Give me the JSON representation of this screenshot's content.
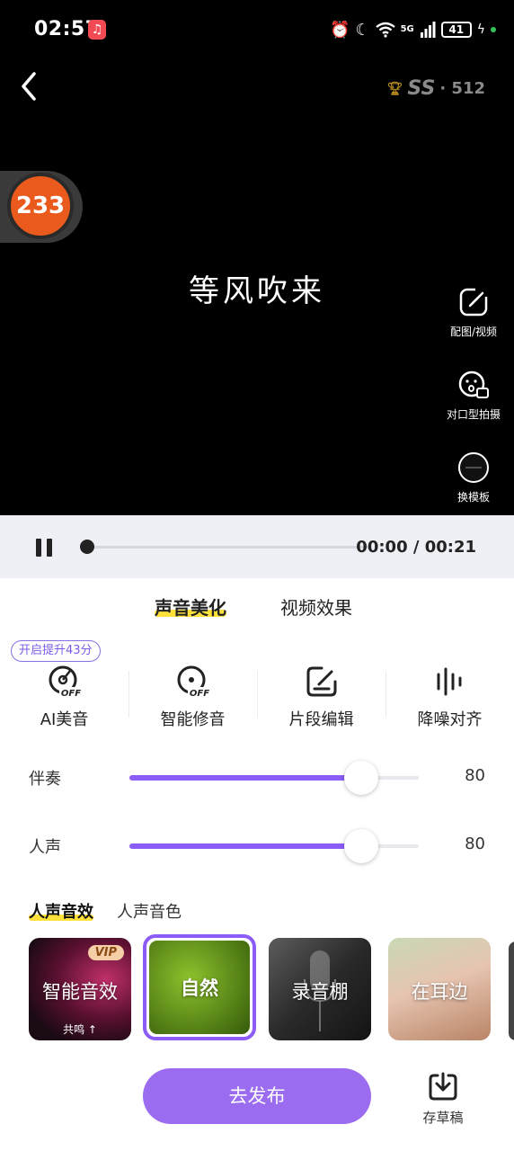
{
  "status_bar": {
    "time": "02:57",
    "network": "5G",
    "battery": "41"
  },
  "header": {
    "score_grade": "SS",
    "score_value": "· 512"
  },
  "badge": {
    "text": "233"
  },
  "video": {
    "title": "等风吹来"
  },
  "side_tools": [
    {
      "label": "配图/视频",
      "icon": "edit-icon"
    },
    {
      "label": "对口型拍摄",
      "icon": "face-camera-icon"
    },
    {
      "label": "换模板",
      "icon": "template-icon"
    }
  ],
  "playback": {
    "current": "00:00",
    "total": "00:21",
    "timecode": "00:00 / 00:21",
    "progress": 0
  },
  "tabs": [
    {
      "label": "声音美化",
      "active": true
    },
    {
      "label": "视频效果",
      "active": false
    }
  ],
  "promo": "开启提升43分",
  "tools": [
    {
      "label": "AI美音",
      "icon": "ai-off-icon"
    },
    {
      "label": "智能修音",
      "icon": "tune-off-icon"
    },
    {
      "label": "片段编辑",
      "icon": "edit-square-icon"
    },
    {
      "label": "降噪对齐",
      "icon": "waveform-icon"
    }
  ],
  "sliders": [
    {
      "label": "伴奏",
      "value": "80",
      "fraction": 0.8
    },
    {
      "label": "人声",
      "value": "80",
      "fraction": 0.8
    }
  ],
  "fx_tabs": [
    {
      "label": "人声音效",
      "active": true
    },
    {
      "label": "人声音色",
      "active": false
    }
  ],
  "effects": [
    {
      "title": "智能音效",
      "badge": "VIP",
      "sub": "共鸣 ↑"
    },
    {
      "title": "自然",
      "selected": true
    },
    {
      "title": "录音棚"
    },
    {
      "title": "在耳边"
    }
  ],
  "actions": {
    "publish": "去发布",
    "draft": "存草稿"
  },
  "colors": {
    "accent": "#8b5cf6",
    "publish": "#9b6cf0",
    "highlight": "#ffe13c",
    "video_bg": "#000000"
  }
}
